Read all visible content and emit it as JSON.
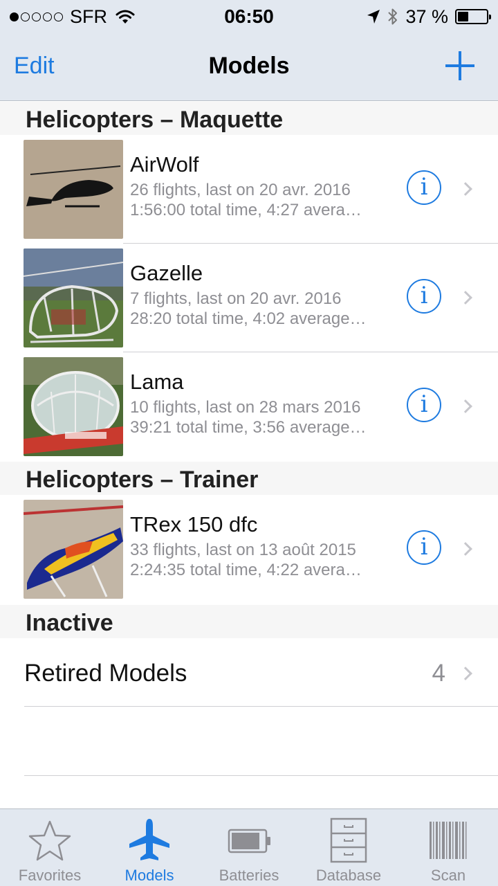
{
  "status_bar": {
    "carrier": "SFR",
    "signal_bars": 1,
    "time": "06:50",
    "battery_percent": "37 %",
    "battery_level": 0.37,
    "icons": [
      "signal-dots-icon",
      "wifi-icon",
      "location-arrow-icon",
      "bluetooth-icon",
      "battery-icon"
    ]
  },
  "nav": {
    "edit_label": "Edit",
    "title": "Models",
    "add_icon": "plus-icon"
  },
  "sections": [
    {
      "title": "Helicopters – Maquette",
      "rows": [
        {
          "name": "AirWolf",
          "line1": "26 flights, last on 20 avr. 2016",
          "line2": "1:56:00 total time, 4:27 avera…",
          "thumb": "airwolf-helicopter-photo"
        },
        {
          "name": "Gazelle",
          "line1": "7 flights, last on 20 avr. 2016",
          "line2": "28:20 total time, 4:02 average…",
          "thumb": "gazelle-helicopter-photo"
        },
        {
          "name": "Lama",
          "line1": "10 flights, last on 28 mars 2016",
          "line2": "39:21 total time, 3:56 average…",
          "thumb": "lama-helicopter-photo"
        }
      ]
    },
    {
      "title": "Helicopters – Trainer",
      "rows": [
        {
          "name": "TRex 150 dfc",
          "line1": "33 flights, last on 13 août 2015",
          "line2": "2:24:35 total time, 4:22 avera…",
          "thumb": "trex-helicopter-photo"
        }
      ]
    },
    {
      "title": "Inactive",
      "retired_label": "Retired Models",
      "retired_count": "4"
    }
  ],
  "tabs": [
    {
      "label": "Favorites",
      "icon": "star-icon",
      "active": false
    },
    {
      "label": "Models",
      "icon": "airplane-icon",
      "active": true
    },
    {
      "label": "Batteries",
      "icon": "battery-icon",
      "active": false
    },
    {
      "label": "Database",
      "icon": "cabinet-icon",
      "active": false
    },
    {
      "label": "Scan",
      "icon": "barcode-icon",
      "active": false
    }
  ],
  "colors": {
    "accent": "#1e7be0",
    "bar_background": "#e2e8f0",
    "section_header": "#f6f6f6",
    "secondary_text": "#8e8e93"
  }
}
